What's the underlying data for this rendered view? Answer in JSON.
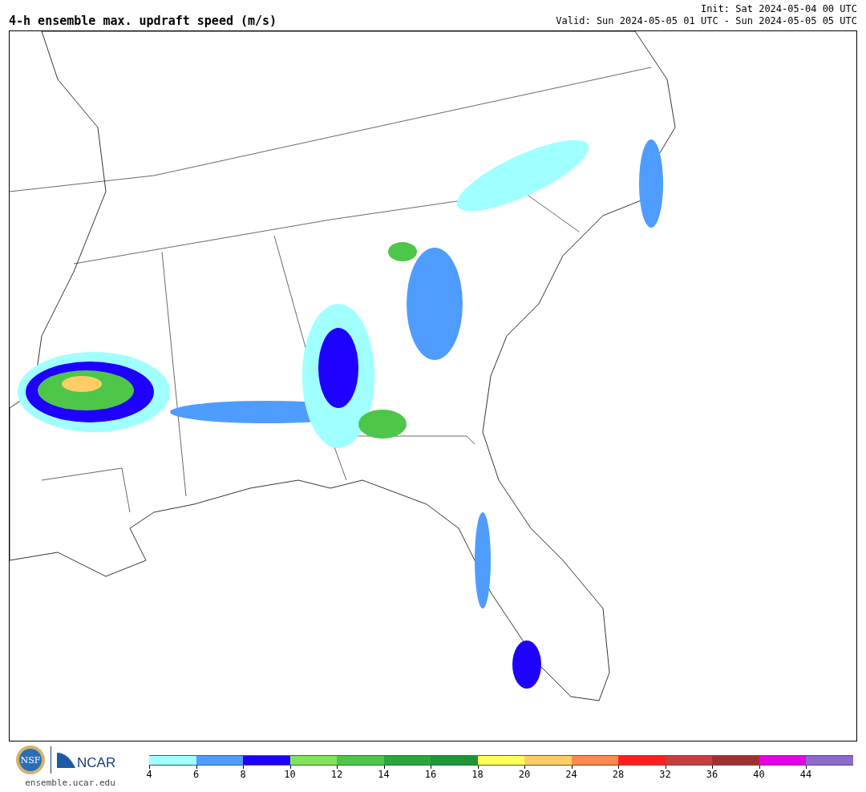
{
  "title": "4-h ensemble max. updraft speed (m/s)",
  "init": "Init: Sat 2024-05-04 00 UTC",
  "valid": "Valid: Sun 2024-05-05 01 UTC - Sun 2024-05-05 05 UTC",
  "logos": {
    "nsf": "NSF",
    "ncar": "NCAR",
    "url": "ensemble.ucar.edu"
  },
  "colorbar": {
    "segments": [
      {
        "color": "#a0ffff"
      },
      {
        "color": "#4f9cff"
      },
      {
        "color": "#1e00ff"
      },
      {
        "color": "#7ee45a"
      },
      {
        "color": "#4dc64a"
      },
      {
        "color": "#2aa63a"
      },
      {
        "color": "#1e9638"
      },
      {
        "color": "#ffff5a"
      },
      {
        "color": "#ffcd65"
      },
      {
        "color": "#ff8a4f"
      },
      {
        "color": "#ff1e1e"
      },
      {
        "color": "#c83c3c"
      },
      {
        "color": "#a03030"
      },
      {
        "color": "#e600e6"
      },
      {
        "color": "#8c69cc"
      }
    ],
    "ticks": [
      "4",
      "6",
      "8",
      "10",
      "12",
      "14",
      "16",
      "18",
      "20",
      "24",
      "28",
      "32",
      "36",
      "40",
      "44"
    ]
  }
}
